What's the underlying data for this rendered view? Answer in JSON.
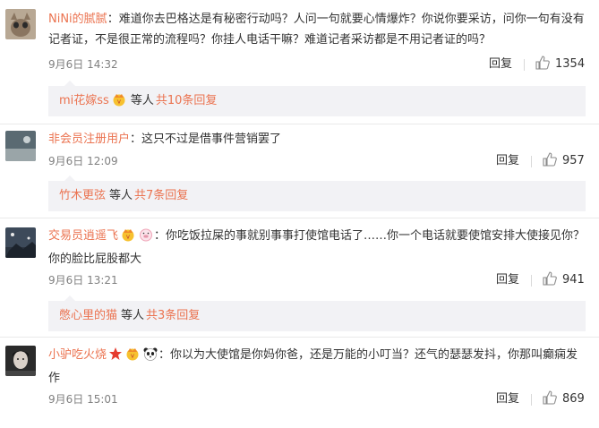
{
  "comments": [
    {
      "username": "NiNi的腻腻",
      "text": "：难道你去巴格达是有秘密行动吗？人问一句就要心情爆炸？你说你要采访，问你一句有没有记者证，不是很正常的流程吗？你挂人电话干嘛？难道记者采访都是不用记者证的吗？",
      "time": "9月6日 14:32",
      "reply_label": "回复",
      "likes": "1354",
      "replies": {
        "first_user": "mi花嫁ss",
        "middle": "等人",
        "link": "共10条回复"
      }
    },
    {
      "username": "非会员注册用户",
      "text": "：这只不过是借事件营销罢了",
      "time": "9月6日 12:09",
      "reply_label": "回复",
      "likes": "957",
      "replies": {
        "first_user": "竹木更弦",
        "middle": "等人",
        "link": "共7条回复"
      }
    },
    {
      "username": "交易员逍遥飞",
      "text": "：你吃饭拉屎的事就别事事打使馆电话了……你一个电话就要使馆安排大使接见你？你的脸比屁股都大",
      "time": "9月6日 13:21",
      "reply_label": "回复",
      "likes": "941",
      "replies": {
        "first_user": "憋心里的猫",
        "middle": "等人",
        "link": "共3条回复"
      }
    },
    {
      "username": "小驴吃火烧",
      "text": "：你以为大使馆是你妈你爸，还是万能的小叮当？还气的瑟瑟发抖，你那叫癫痫发作",
      "time": "9月6日 15:01",
      "reply_label": "回复",
      "likes": "869"
    }
  ],
  "colors": {
    "accent": "#eb7350",
    "reply_bg": "#f2f2f5",
    "meta": "#808080"
  },
  "icons": {
    "like": "thumbs-up-icon",
    "vip": "vip-crown-icon",
    "star": "star-icon",
    "pig": "pig-face-icon",
    "panda": "panda-face-icon"
  }
}
